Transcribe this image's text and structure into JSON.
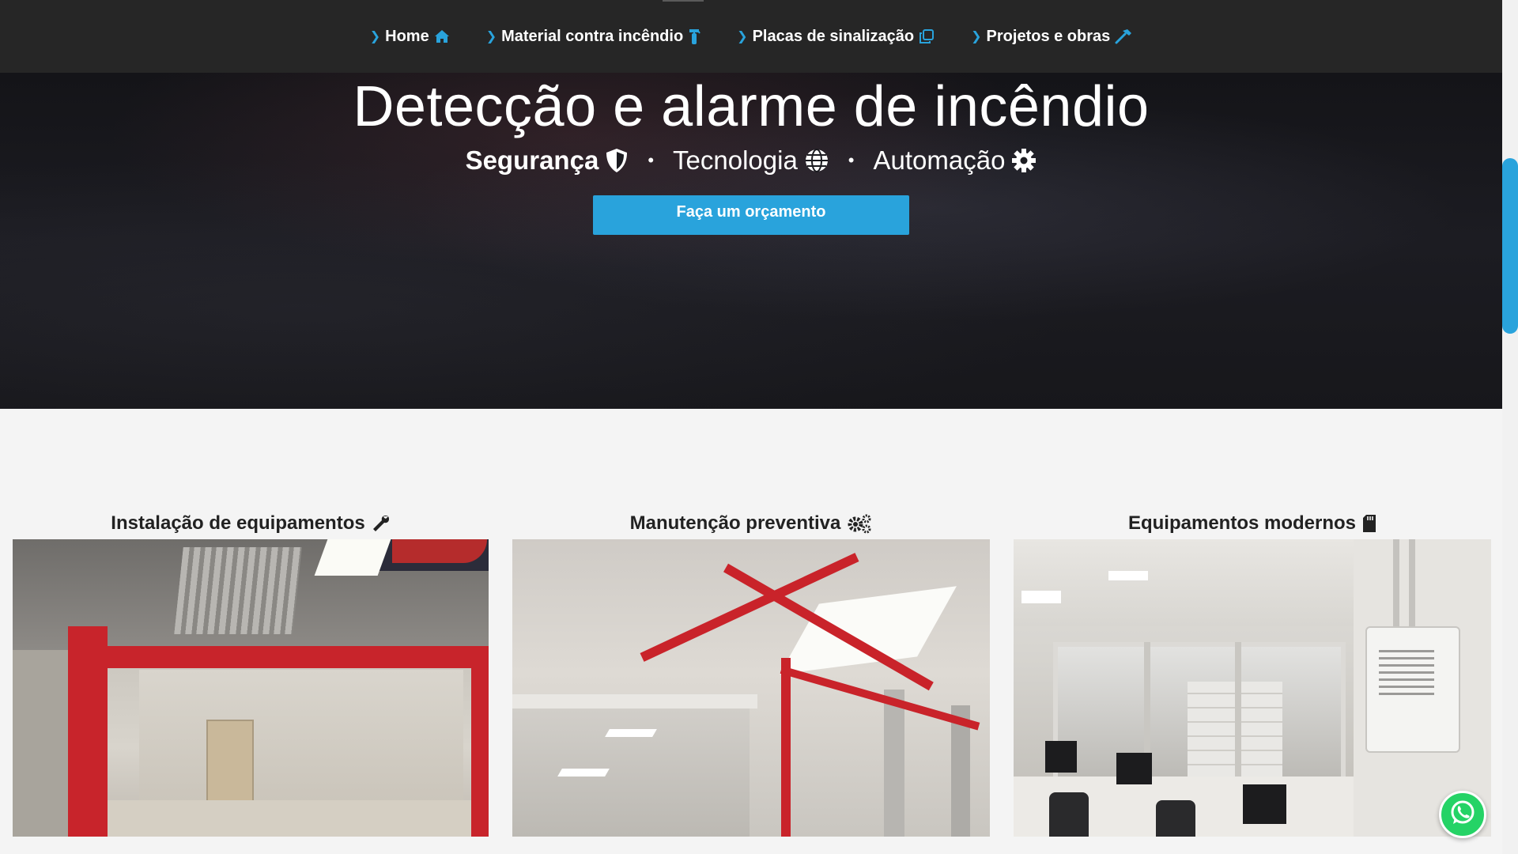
{
  "nav": {
    "items": [
      {
        "label": "Home",
        "icon": "home-icon"
      },
      {
        "label": "Material contra incêndio",
        "icon": "fire-extinguisher-icon"
      },
      {
        "label": "Placas de sinalização",
        "icon": "clone-icon"
      },
      {
        "label": "Projetos e obras",
        "icon": "hammer-icon"
      }
    ]
  },
  "hero": {
    "title": "Detecção e alarme de incêndio",
    "subtitle": [
      {
        "label": "Segurança",
        "icon": "shield-icon"
      },
      {
        "label": "Tecnologia",
        "icon": "globe-icon"
      },
      {
        "label": "Automação",
        "icon": "gear-icon"
      }
    ],
    "separator": "•",
    "cta_label": "Faça um orçamento"
  },
  "features": [
    {
      "title": "Instalação de equipamentos",
      "icon": "wrench-icon"
    },
    {
      "title": "Manutenção preventiva",
      "icon": "gears-icon"
    },
    {
      "title": "Equipamentos modernos",
      "icon": "sd-card-icon"
    }
  ],
  "colors": {
    "accent": "#29a3dc",
    "nav_bg": "#262626",
    "whatsapp": "#25d366"
  }
}
